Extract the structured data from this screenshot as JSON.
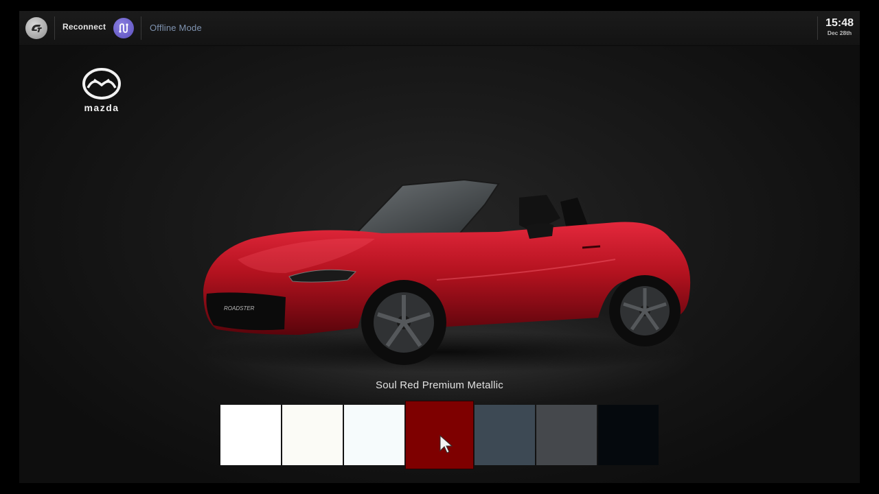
{
  "topbar": {
    "reconnect_label": "Reconnect",
    "status_label": "Offline Mode",
    "time": "15:48",
    "date": "Dec 28th"
  },
  "brand": {
    "name": "mazda"
  },
  "car": {
    "badge_text": "ROADSTER"
  },
  "paint": {
    "selected_name": "Soul Red Premium Metallic",
    "swatches": [
      {
        "color": "#ffffff"
      },
      {
        "color": "#fbfbf6"
      },
      {
        "color": "#f6fbfc"
      },
      {
        "color": "#7e0000",
        "selected": true
      },
      {
        "color": "#3d4954"
      },
      {
        "color": "#45484c"
      },
      {
        "color": "#05090d"
      }
    ]
  },
  "icons": [
    "gt-logo-icon",
    "network-icon",
    "mazda-logo-icon",
    "pointer-cursor-icon"
  ]
}
